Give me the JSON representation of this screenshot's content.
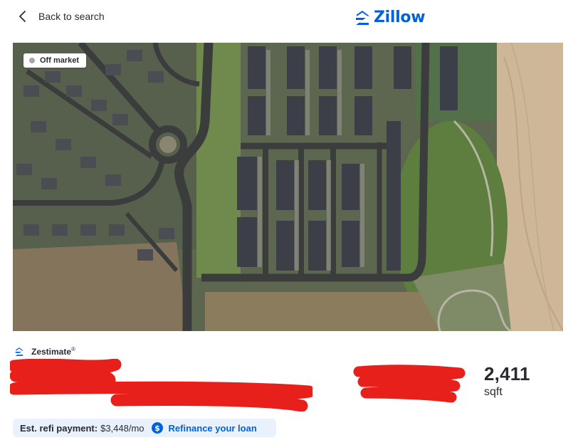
{
  "header": {
    "back_label": "Back to search",
    "logo_text": "Zillow"
  },
  "listing": {
    "status_badge": "Off market",
    "photo_alt": "Aerial view of neighborhood"
  },
  "estimate": {
    "zestimate_label": "Zestimate",
    "zestimate_mark": "®",
    "sqft_value": "2,411",
    "sqft_unit": "sqft"
  },
  "refi": {
    "label": "Est. refi payment:",
    "value": "$3,448/mo",
    "link_label": "Refinance your loan"
  },
  "colors": {
    "brand_blue": "#0061df",
    "redaction_red": "#e8201c",
    "refi_background": "#e9f2fc"
  }
}
